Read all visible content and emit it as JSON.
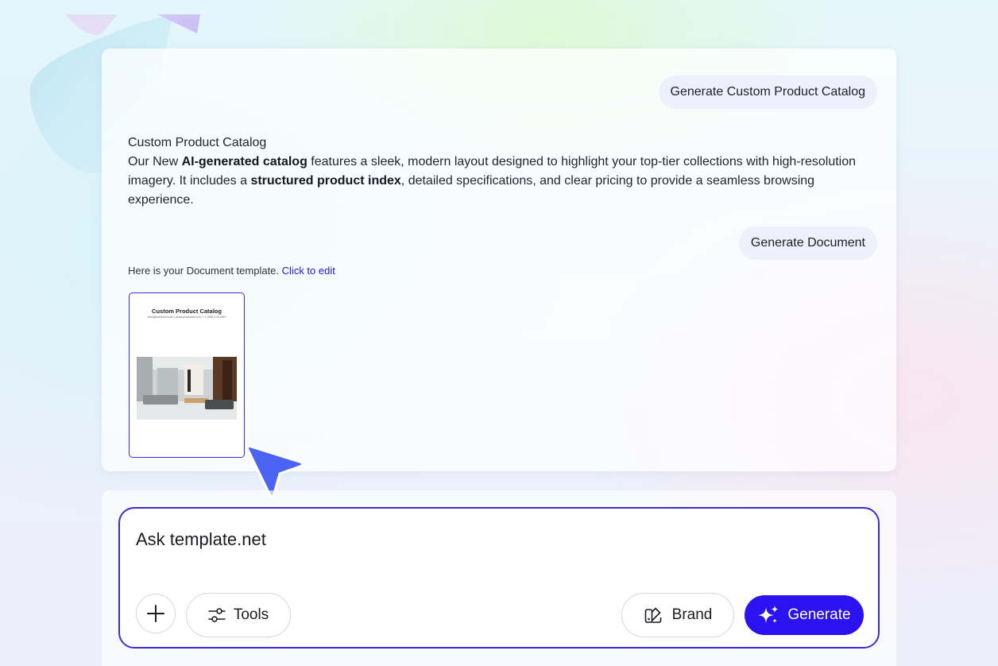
{
  "conversation": {
    "user_prompt_1": "Generate Custom Product Catalog",
    "ai_response": {
      "heading": "Custom Product Catalog",
      "p_intro": "Our New ",
      "p_bold1": "AI-generated catalog",
      "p_mid": " features a sleek, modern layout designed to highlight your top-tier collections with high-resolution imagery. It includes a ",
      "p_bold2": "structured product index",
      "p_end": ", detailed specifications, and clear pricing to provide a seamless browsing experience."
    },
    "user_prompt_2": "Generate Document",
    "template_message": "Here is your Document template.",
    "template_link": "Click to edit",
    "thumbnail": {
      "title": "Custom Product Catalog",
      "subtitle": "info@yourbrand.com | www.yourbrand.com | +1 (555) 123-4567"
    }
  },
  "composer": {
    "placeholder": "Ask template.net",
    "plus_icon": "plus-icon",
    "tools_label": "Tools",
    "tools_icon": "sliders-icon",
    "brand_label": "Brand",
    "brand_icon": "swatch-icon",
    "generate_label": "Generate",
    "generate_icon": "sparkles-icon"
  },
  "colors": {
    "accent": "#2a13f0",
    "link": "#2215d6",
    "chip_bg": "#eef0fb",
    "input_border": "#3a2bd9"
  }
}
